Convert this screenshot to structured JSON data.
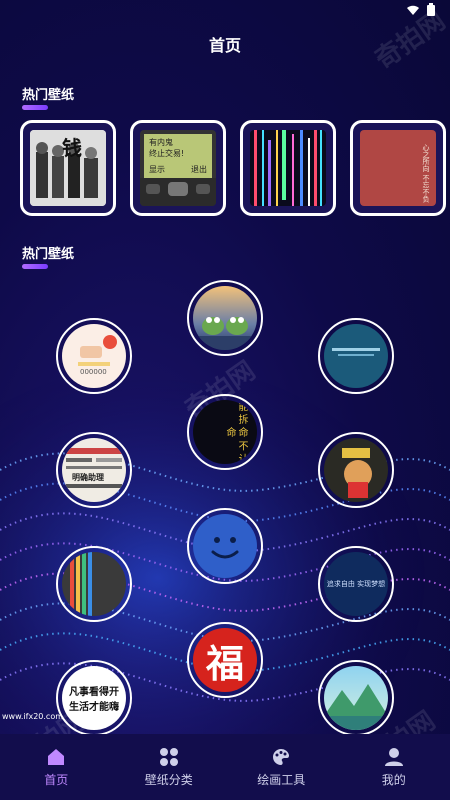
{
  "header": {
    "title": "首页"
  },
  "sections": {
    "hot_title": "热门壁纸",
    "hot_title_2": "热门壁纸"
  },
  "hot_cards": [
    {
      "name": "people-photo",
      "text": "钱"
    },
    {
      "name": "phone-screen",
      "line1": "有内鬼",
      "line2": "终止交易!",
      "left": "显示",
      "right": "退出"
    },
    {
      "name": "glitch-lines"
    },
    {
      "name": "red-poem",
      "text": "心之所向 不忘不负"
    }
  ],
  "circles": {
    "fries": {
      "text": "000000"
    },
    "frogs": {},
    "teal": {},
    "ninja": {
      "text": "能 拆 命 不 认 命"
    },
    "news": {
      "text": "明确助理"
    },
    "kid": {},
    "smiley": {},
    "lines": {},
    "text_blue": {
      "text": "追求自由 实现梦想"
    },
    "fu": {
      "text": "福"
    },
    "motto": {
      "line1": "凡事看得开",
      "line2": "生活才能嗨",
      "caption": "www.ifx20.com"
    },
    "mountain": {}
  },
  "tabbar": {
    "home": "首页",
    "category": "壁纸分类",
    "draw": "绘画工具",
    "mine": "我的"
  },
  "watermark": "奇拍网",
  "colors": {
    "bg": "#0e0a48",
    "accent": "#c089ff",
    "bar": "#9b55ff"
  }
}
